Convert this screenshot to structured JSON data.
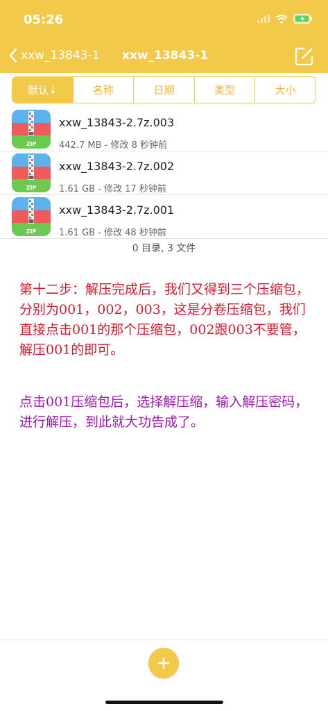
{
  "status_bar": {
    "time": "05:26"
  },
  "nav": {
    "back_label": "xxw_13843-1",
    "title": "xxw_13843-1"
  },
  "sort_tabs": [
    {
      "label": "默认↓",
      "active": true
    },
    {
      "label": "名称"
    },
    {
      "label": "日期"
    },
    {
      "label": "类型"
    },
    {
      "label": "大小"
    }
  ],
  "files": [
    {
      "name": "xxw_13843-2.7z.003",
      "meta": "442.7 MB - 修改 8 秒钟前",
      "icon": "zip-icon"
    },
    {
      "name": "xxw_13843-2.7z.002",
      "meta": "1.61 GB - 修改 17 秒钟前",
      "icon": "zip-icon"
    },
    {
      "name": "xxw_13843-2.7z.001",
      "meta": "1.61 GB - 修改 48 秒钟前",
      "icon": "zip-icon"
    }
  ],
  "summary": "0 目录, 3 文件",
  "annotations": {
    "step12": "第十二步：解压完成后，我们又得到三个压缩包，分别为001，002，003，这是分卷压缩包，我们直接点击001的那个压缩包，002跟003不要管，解压001的即可。",
    "step_next": "点击001压缩包后，选择解压缩，输入解压密码，进行解压，到此就大功告成了。"
  },
  "colors": {
    "accent": "#f3c94a",
    "annotation_red": "#d31b2d",
    "annotation_purple": "#a019b4"
  }
}
